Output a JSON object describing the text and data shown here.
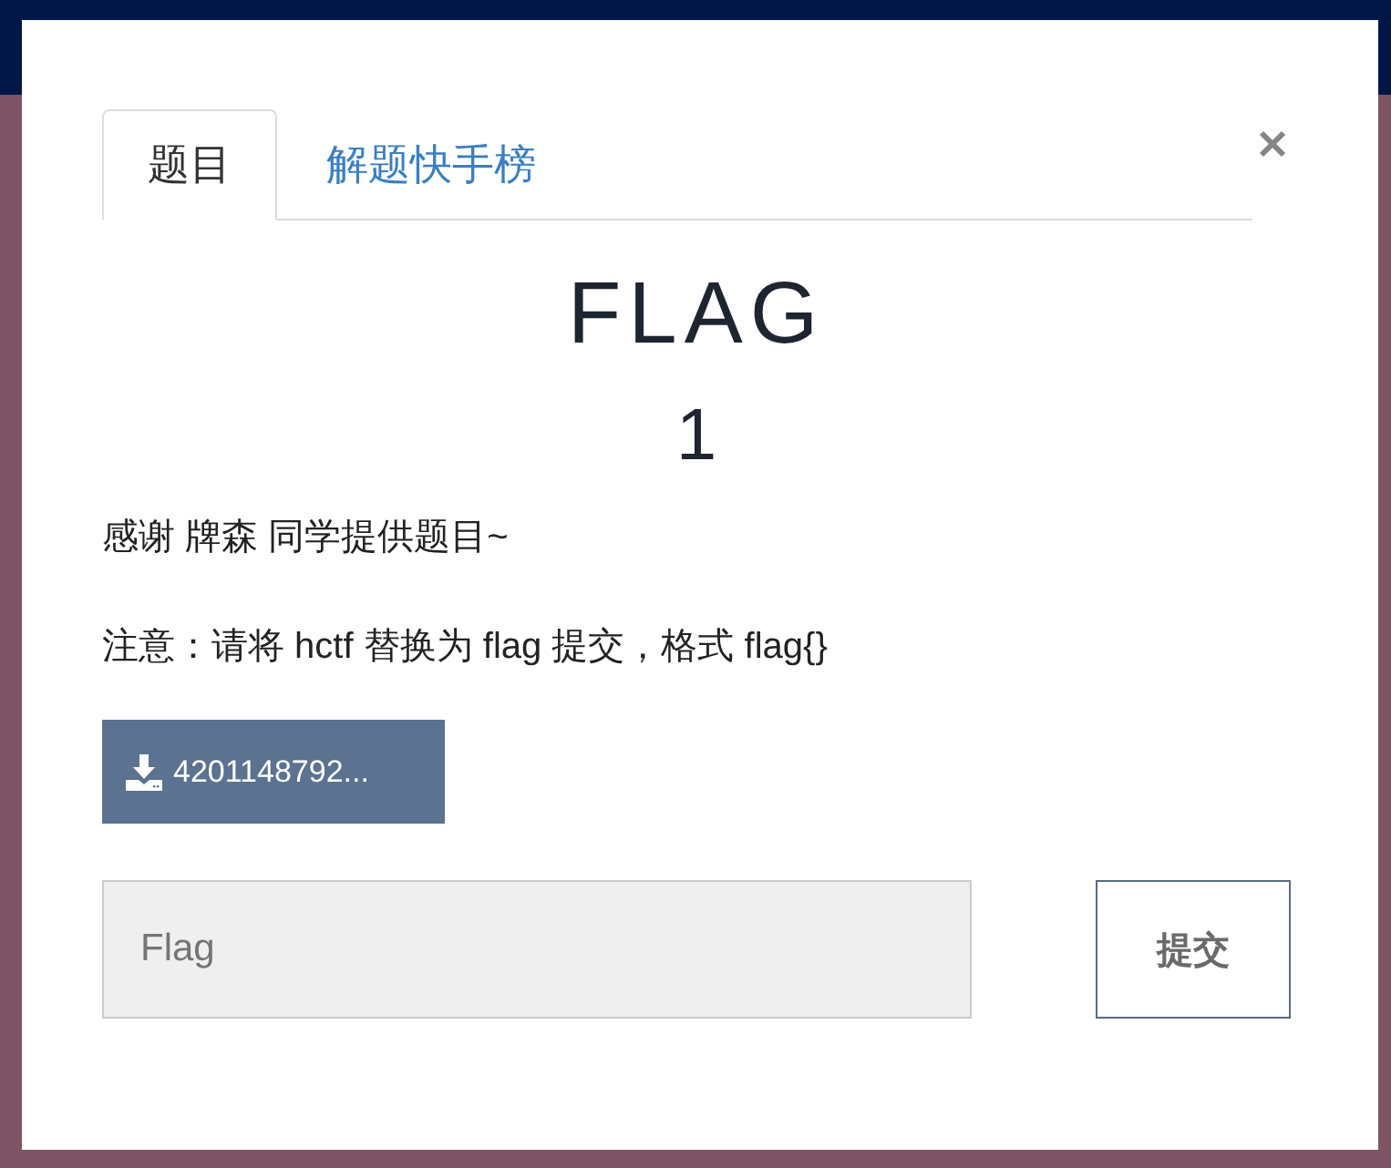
{
  "tabs": [
    {
      "label": "题目",
      "selected": true
    },
    {
      "label": "解题快手榜",
      "selected": false
    }
  ],
  "challenge": {
    "title": "FLAG",
    "points": "1",
    "description": [
      "感谢 牌森 同学提供题目~",
      "注意：请将 hctf 替换为 flag 提交，格式 flag{}"
    ],
    "attachment": "4201148792..."
  },
  "submit_form": {
    "placeholder": "Flag",
    "button": "提交"
  }
}
